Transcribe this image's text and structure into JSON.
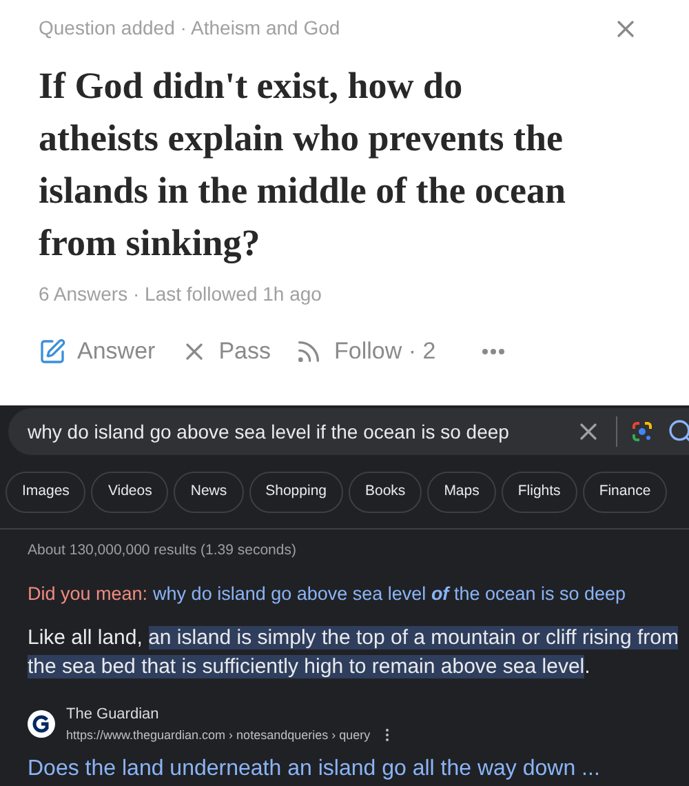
{
  "question_card": {
    "context": "Question added · Atheism and God",
    "title": "If God didn't exist, how do atheists explain who prevents the islands in the middle of the ocean from sinking?",
    "meta": "6 Answers · Last followed 1h ago",
    "actions": [
      {
        "kind": "answer",
        "label": "Answer"
      },
      {
        "kind": "pass",
        "label": "Pass"
      },
      {
        "kind": "follow",
        "label": "Follow · 2"
      }
    ]
  },
  "search": {
    "query": "why do island go above sea level if the ocean is so deep",
    "filters": [
      {
        "label": "Images"
      },
      {
        "label": "Videos"
      },
      {
        "label": "News"
      },
      {
        "label": "Shopping"
      },
      {
        "label": "Books"
      },
      {
        "label": "Maps"
      },
      {
        "label": "Flights"
      },
      {
        "label": "Finance"
      }
    ],
    "stats": "About 130,000,000 results (1.39 seconds)",
    "did_you_mean": {
      "label": "Did you mean:",
      "suggestion": "why do island go above sea level *of* the ocean is so deep"
    },
    "snippet": {
      "lead": "Like all land, ",
      "highlighted": "an island is simply the top of a mountain or cliff rising from the sea bed that is sufficiently high to remain above sea level",
      "tail": "."
    },
    "result": {
      "site": "The Guardian",
      "url": "https://www.theguardian.com › notesandqueries › query",
      "title": "Does the land underneath an island go all the way down ..."
    }
  }
}
